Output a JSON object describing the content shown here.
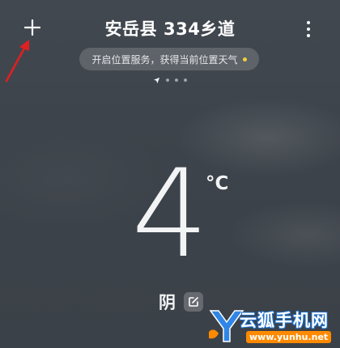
{
  "header": {
    "title": "安岳县 334乡道",
    "add_icon": "plus-icon",
    "more_icon": "more-vertical-icon"
  },
  "location_prompt": {
    "text": "开启位置服务，获得当前位置天气",
    "dot_color": "#f4cf3d"
  },
  "page_indicator": {
    "current_icon": "location-arrow-icon",
    "extra_pages": 3
  },
  "weather": {
    "temperature": "4",
    "unit": "°C",
    "condition": "阴",
    "edit_icon": "edit-icon"
  },
  "annotation": {
    "arrow_color": "#e02020"
  },
  "watermark": {
    "name": "云狐手机网",
    "url": "www.yunhu.net"
  }
}
